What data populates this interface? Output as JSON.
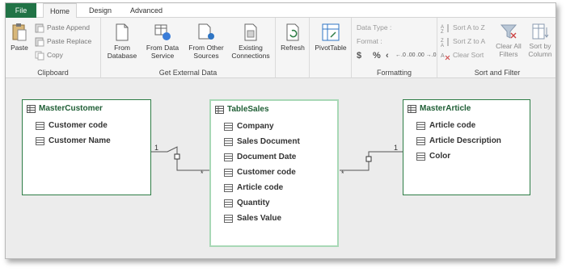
{
  "tabs": {
    "file": "File",
    "home": "Home",
    "design": "Design",
    "advanced": "Advanced"
  },
  "clipboard": {
    "paste": "Paste",
    "paste_append": "Paste Append",
    "paste_replace": "Paste Replace",
    "copy": "Copy",
    "label": "Clipboard"
  },
  "external": {
    "from_database_1": "From",
    "from_database_2": "Database",
    "from_data_service_1": "From Data",
    "from_data_service_2": "Service",
    "from_other_1": "From Other",
    "from_other_2": "Sources",
    "existing_1": "Existing",
    "existing_2": "Connections",
    "label": "Get External Data"
  },
  "refresh": {
    "label": "Refresh"
  },
  "pivot": {
    "label": "PivotTable"
  },
  "formatting": {
    "data_type": "Data Type :",
    "format": "Format :",
    "dollar": "$",
    "percent": "%",
    "comma": "‹",
    "inc": "←.0 .00",
    "dec": ".00 →.0",
    "label": "Formatting"
  },
  "sort": {
    "sort_az": "Sort A to Z",
    "sort_za": "Sort Z to A",
    "clear_sort": "Clear Sort",
    "clear_filters_1": "Clear All",
    "clear_filters_2": "Filters",
    "sort_by_1": "Sort by",
    "sort_by_2": "Column",
    "label": "Sort and Filter"
  },
  "tables": {
    "master_customer": {
      "title": "MasterCustomer",
      "fields": [
        "Customer code",
        "Customer Name"
      ]
    },
    "table_sales": {
      "title": "TableSales",
      "fields": [
        "Company",
        "Sales Document",
        "Document Date",
        "Customer code",
        "Article code",
        "Quantity",
        "Sales Value"
      ]
    },
    "master_article": {
      "title": "MasterArticle",
      "fields": [
        "Article code",
        "Article Description",
        "Color"
      ]
    }
  },
  "relationships": {
    "left_one": "1",
    "left_many": "*",
    "right_one": "1",
    "right_many": "*"
  },
  "colors": {
    "accent": "#217346",
    "table_border": "#2e7d46",
    "selected_border": "#a8d8b6"
  }
}
